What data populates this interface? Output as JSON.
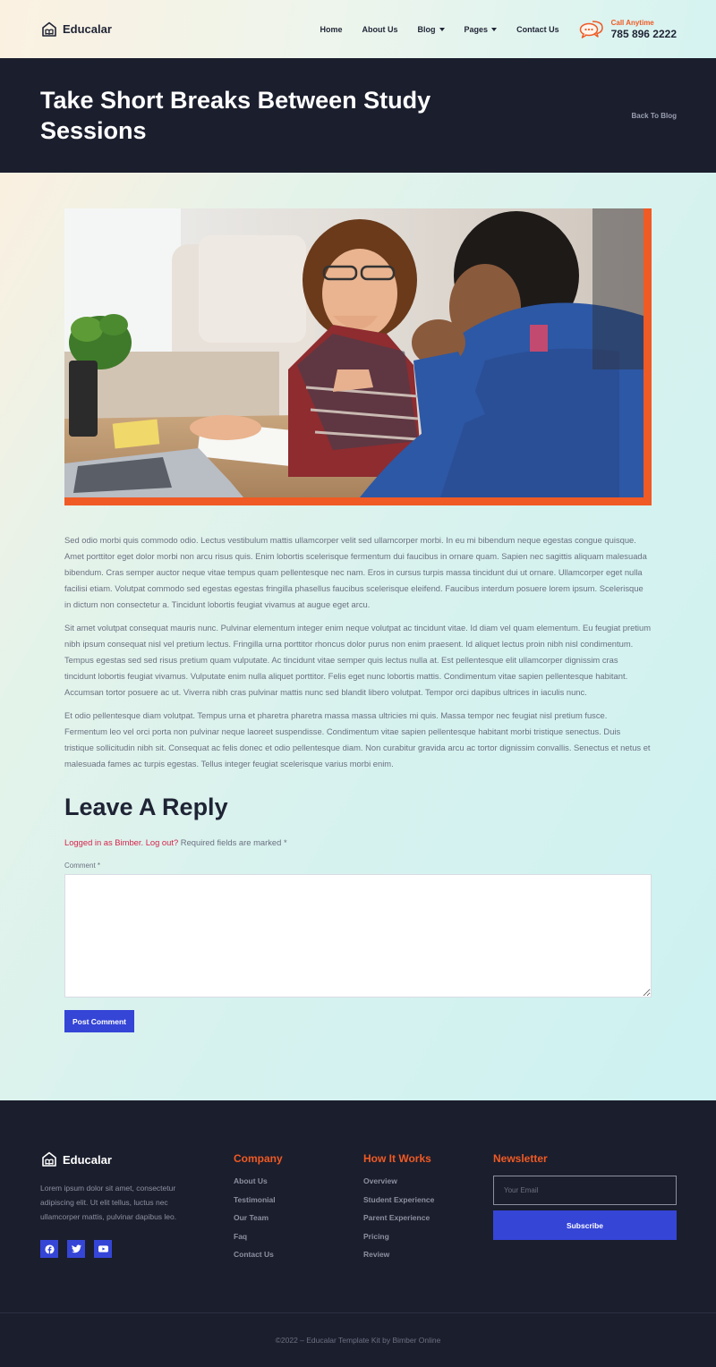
{
  "brand": {
    "name": "Educalar",
    "accent_color": "#f05a24",
    "primary_button_color": "#3545d6",
    "dark_color": "#1b1e2d"
  },
  "nav": {
    "items": [
      {
        "label": "Home",
        "dropdown": false
      },
      {
        "label": "About Us",
        "dropdown": false
      },
      {
        "label": "Blog",
        "dropdown": true
      },
      {
        "label": "Pages",
        "dropdown": true
      },
      {
        "label": "Contact Us",
        "dropdown": false
      }
    ],
    "call_label": "Call Anytime",
    "call_number": "785 896 2222"
  },
  "banner": {
    "title": "Take Short Breaks Between Study Sessions",
    "back_link": "Back To Blog"
  },
  "article": {
    "paragraphs": [
      "Sed odio morbi quis commodo odio. Lectus vestibulum mattis ullamcorper velit sed ullamcorper morbi. In eu mi bibendum neque egestas congue quisque. Amet porttitor eget dolor morbi non arcu risus quis. Enim lobortis scelerisque fermentum dui faucibus in ornare quam. Sapien nec sagittis aliquam malesuada bibendum. Cras semper auctor neque vitae tempus quam pellentesque nec nam. Eros in cursus turpis massa tincidunt dui ut ornare. Ullamcorper eget nulla facilisi etiam. Volutpat commodo sed egestas egestas fringilla phasellus faucibus scelerisque eleifend. Faucibus interdum posuere lorem ipsum. Scelerisque in dictum non consectetur a. Tincidunt lobortis feugiat vivamus at augue eget arcu.",
      "Sit amet volutpat consequat mauris nunc. Pulvinar elementum integer enim neque volutpat ac tincidunt vitae. Id diam vel quam elementum. Eu feugiat pretium nibh ipsum consequat nisl vel pretium lectus. Fringilla urna porttitor rhoncus dolor purus non enim praesent. Id aliquet lectus proin nibh nisl condimentum. Tempus egestas sed sed risus pretium quam vulputate. Ac tincidunt vitae semper quis lectus nulla at. Est pellentesque elit ullamcorper dignissim cras tincidunt lobortis feugiat vivamus. Vulputate enim nulla aliquet porttitor. Felis eget nunc lobortis mattis. Condimentum vitae sapien pellentesque habitant. Accumsan tortor posuere ac ut. Viverra nibh cras pulvinar mattis nunc sed blandit libero volutpat. Tempor orci dapibus ultrices in iaculis nunc.",
      "Et odio pellentesque diam volutpat. Tempus urna et pharetra pharetra massa massa ultricies mi quis. Massa tempor nec feugiat nisl pretium fusce. Fermentum leo vel orci porta non pulvinar neque laoreet suspendisse. Condimentum vitae sapien pellentesque habitant morbi tristique senectus. Duis tristique sollicitudin nibh sit. Consequat ac felis donec et odio pellentesque diam. Non curabitur gravida arcu ac tortor dignissim convallis. Senectus et netus et malesuada fames ac turpis egestas. Tellus integer feugiat scelerisque varius morbi enim."
    ]
  },
  "reply": {
    "title": "Leave A Reply",
    "logged_in_link": "Logged in as Bimber.",
    "logout_link": "Log out?",
    "required_note": " Required fields are marked *",
    "comment_label": "Comment *",
    "comment_value": "",
    "submit_label": "Post Comment"
  },
  "footer": {
    "description": "Lorem ipsum dolor sit amet, consectetur adipiscing elit. Ut elit tellus, luctus nec ullamcorper mattis, pulvinar dapibus leo.",
    "socials": [
      "facebook-icon",
      "twitter-icon",
      "youtube-icon"
    ],
    "company": {
      "heading": "Company",
      "links": [
        "About Us",
        "Testimonial",
        "Our Team",
        "Faq",
        "Contact Us"
      ]
    },
    "how_it_works": {
      "heading": "How It Works",
      "links": [
        "Overview",
        "Student Experience",
        "Parent Experience",
        "Pricing",
        "Review"
      ]
    },
    "newsletter": {
      "heading": "Newsletter",
      "email_placeholder": "Your Email",
      "subscribe_label": "Subscribe"
    },
    "copyright": "©2022 – Educalar Template Kit by Bimber Online"
  }
}
